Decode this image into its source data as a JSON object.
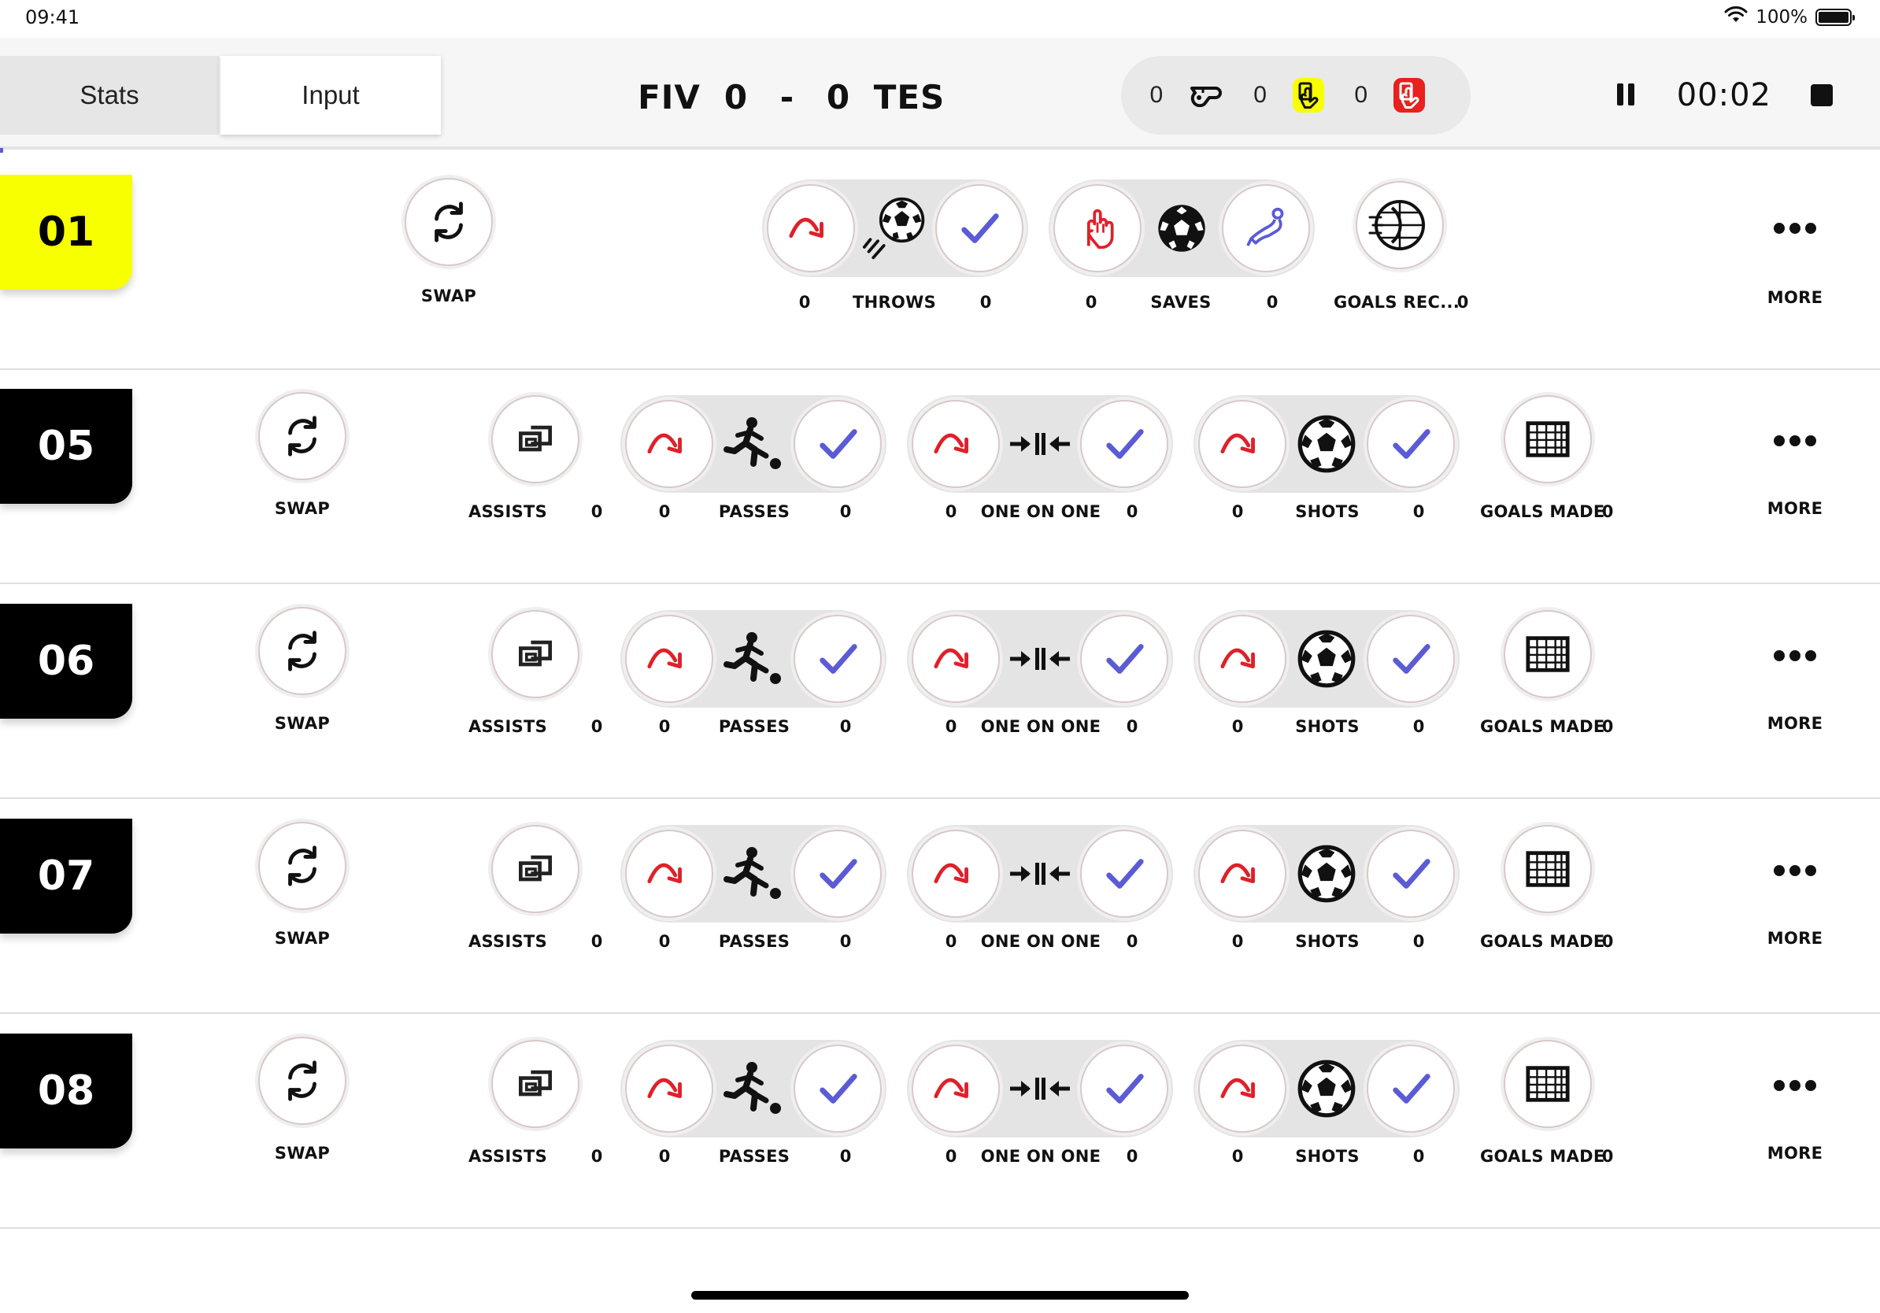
{
  "status_bar": {
    "time": "09:41",
    "battery": "100%",
    "battery_level": 1.0
  },
  "header": {
    "tabs": [
      {
        "label": "Stats",
        "active": false
      },
      {
        "label": "Input",
        "active": true
      }
    ],
    "score": {
      "team_home": "FIV",
      "home_score": "0",
      "separator": "-",
      "away_score": "0",
      "team_away": "TES"
    },
    "cards": {
      "whistle_count": "0",
      "yellow_count": "0",
      "red_count": "0"
    },
    "timer": "00:02"
  },
  "colors": {
    "accent_yellow": "#f7ff00",
    "miss_red": "#e0202a",
    "success_blue": "#5b5bd6",
    "card_yellow": "#f7ff00",
    "card_red": "#e8201e"
  },
  "keeper_row": {
    "number": "01",
    "swap_label": "SWAP",
    "throws": {
      "label": "THROWS",
      "miss": "0",
      "success": "0"
    },
    "saves": {
      "label": "SAVES",
      "miss": "0",
      "success": "0"
    },
    "goals_received": {
      "label": "GOALS REC...",
      "value": "0"
    },
    "more_label": "MORE"
  },
  "player_rows": [
    {
      "number": "05",
      "swap_label": "SWAP",
      "assists": {
        "label": "ASSISTS",
        "value": "0"
      },
      "passes": {
        "label": "PASSES",
        "miss": "0",
        "success": "0"
      },
      "one_on_one": {
        "label": "ONE ON ONE",
        "miss": "0",
        "success": "0"
      },
      "shots": {
        "label": "SHOTS",
        "miss": "0",
        "success": "0"
      },
      "goals_made": {
        "label": "GOALS MADE",
        "value": "0"
      },
      "more_label": "MORE"
    },
    {
      "number": "06",
      "swap_label": "SWAP",
      "assists": {
        "label": "ASSISTS",
        "value": "0"
      },
      "passes": {
        "label": "PASSES",
        "miss": "0",
        "success": "0"
      },
      "one_on_one": {
        "label": "ONE ON ONE",
        "miss": "0",
        "success": "0"
      },
      "shots": {
        "label": "SHOTS",
        "miss": "0",
        "success": "0"
      },
      "goals_made": {
        "label": "GOALS MADE",
        "value": "0"
      },
      "more_label": "MORE"
    },
    {
      "number": "07",
      "swap_label": "SWAP",
      "assists": {
        "label": "ASSISTS",
        "value": "0"
      },
      "passes": {
        "label": "PASSES",
        "miss": "0",
        "success": "0"
      },
      "one_on_one": {
        "label": "ONE ON ONE",
        "miss": "0",
        "success": "0"
      },
      "shots": {
        "label": "SHOTS",
        "miss": "0",
        "success": "0"
      },
      "goals_made": {
        "label": "GOALS MADE",
        "value": "0"
      },
      "more_label": "MORE"
    },
    {
      "number": "08",
      "swap_label": "SWAP",
      "assists": {
        "label": "ASSISTS",
        "value": "0"
      },
      "passes": {
        "label": "PASSES",
        "miss": "0",
        "success": "0"
      },
      "one_on_one": {
        "label": "ONE ON ONE",
        "miss": "0",
        "success": "0"
      },
      "shots": {
        "label": "SHOTS",
        "miss": "0",
        "success": "0"
      },
      "goals_made": {
        "label": "GOALS MADE",
        "value": "0"
      },
      "more_label": "MORE"
    }
  ],
  "icons": {
    "swap": "swap-icon",
    "miss": "miss-arrow-icon",
    "success": "checkmark-icon",
    "throw": "ball-throw-icon",
    "save_hand": "goalkeeper-glove-icon",
    "save_ball": "ball-icon",
    "save_dive": "dive-save-icon",
    "goal_received": "goal-received-icon",
    "assist": "assist-icon",
    "pass": "kicking-player-icon",
    "one_on_one": "one-on-one-icon",
    "shot": "soccer-ball-icon",
    "goal": "goal-net-icon",
    "more": "more-dots-icon",
    "whistle": "whistle-icon",
    "yellow_card": "yellow-card-icon",
    "red_card": "red-card-icon"
  }
}
